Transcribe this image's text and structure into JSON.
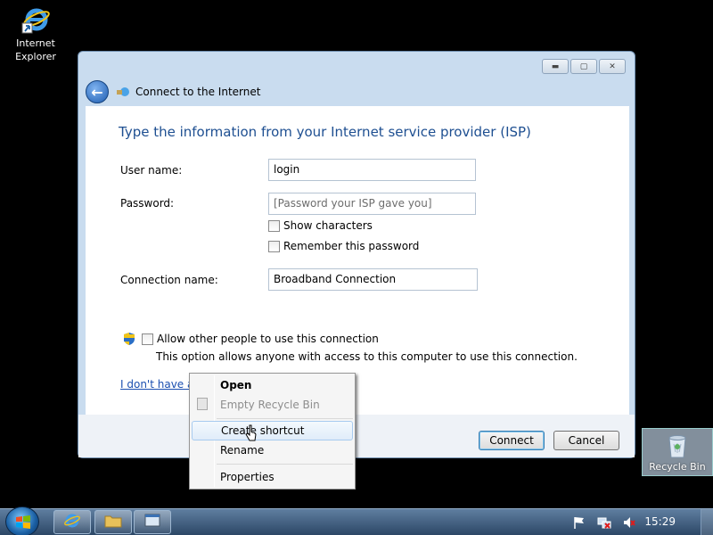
{
  "desktop": {
    "icons": [
      {
        "label_line1": "Internet",
        "label_line2": "Explorer",
        "icon": "internet-explorer-icon"
      },
      {
        "label": "Recycle Bin",
        "icon": "recycle-bin-icon"
      }
    ]
  },
  "window": {
    "title": "Connect to the Internet",
    "heading": "Type the information from your Internet service provider (ISP)",
    "fields": {
      "username_label": "User name:",
      "username_value": "login",
      "password_label": "Password:",
      "password_placeholder": "[Password your ISP gave you]",
      "show_characters": "Show characters",
      "remember_password": "Remember this password",
      "connection_label": "Connection name:",
      "connection_value": "Broadband Connection"
    },
    "allow": {
      "label": "Allow other people to use this connection",
      "description": "This option allows anyone with access to this computer to use this connection."
    },
    "link": "I don't have an ISP",
    "buttons": {
      "connect": "Connect",
      "cancel": "Cancel"
    }
  },
  "context_menu": {
    "items": [
      {
        "label": "Open",
        "bold": true
      },
      {
        "label": "Empty Recycle Bin",
        "disabled": true
      },
      {
        "label": "Create shortcut",
        "hover": true
      },
      {
        "label": "Rename"
      },
      {
        "label": "Properties"
      }
    ]
  },
  "taskbar": {
    "clock": "15:29"
  },
  "colors": {
    "heading": "#1e4f91",
    "link": "#1b4fb0",
    "window_frame": "#c9dcef"
  }
}
